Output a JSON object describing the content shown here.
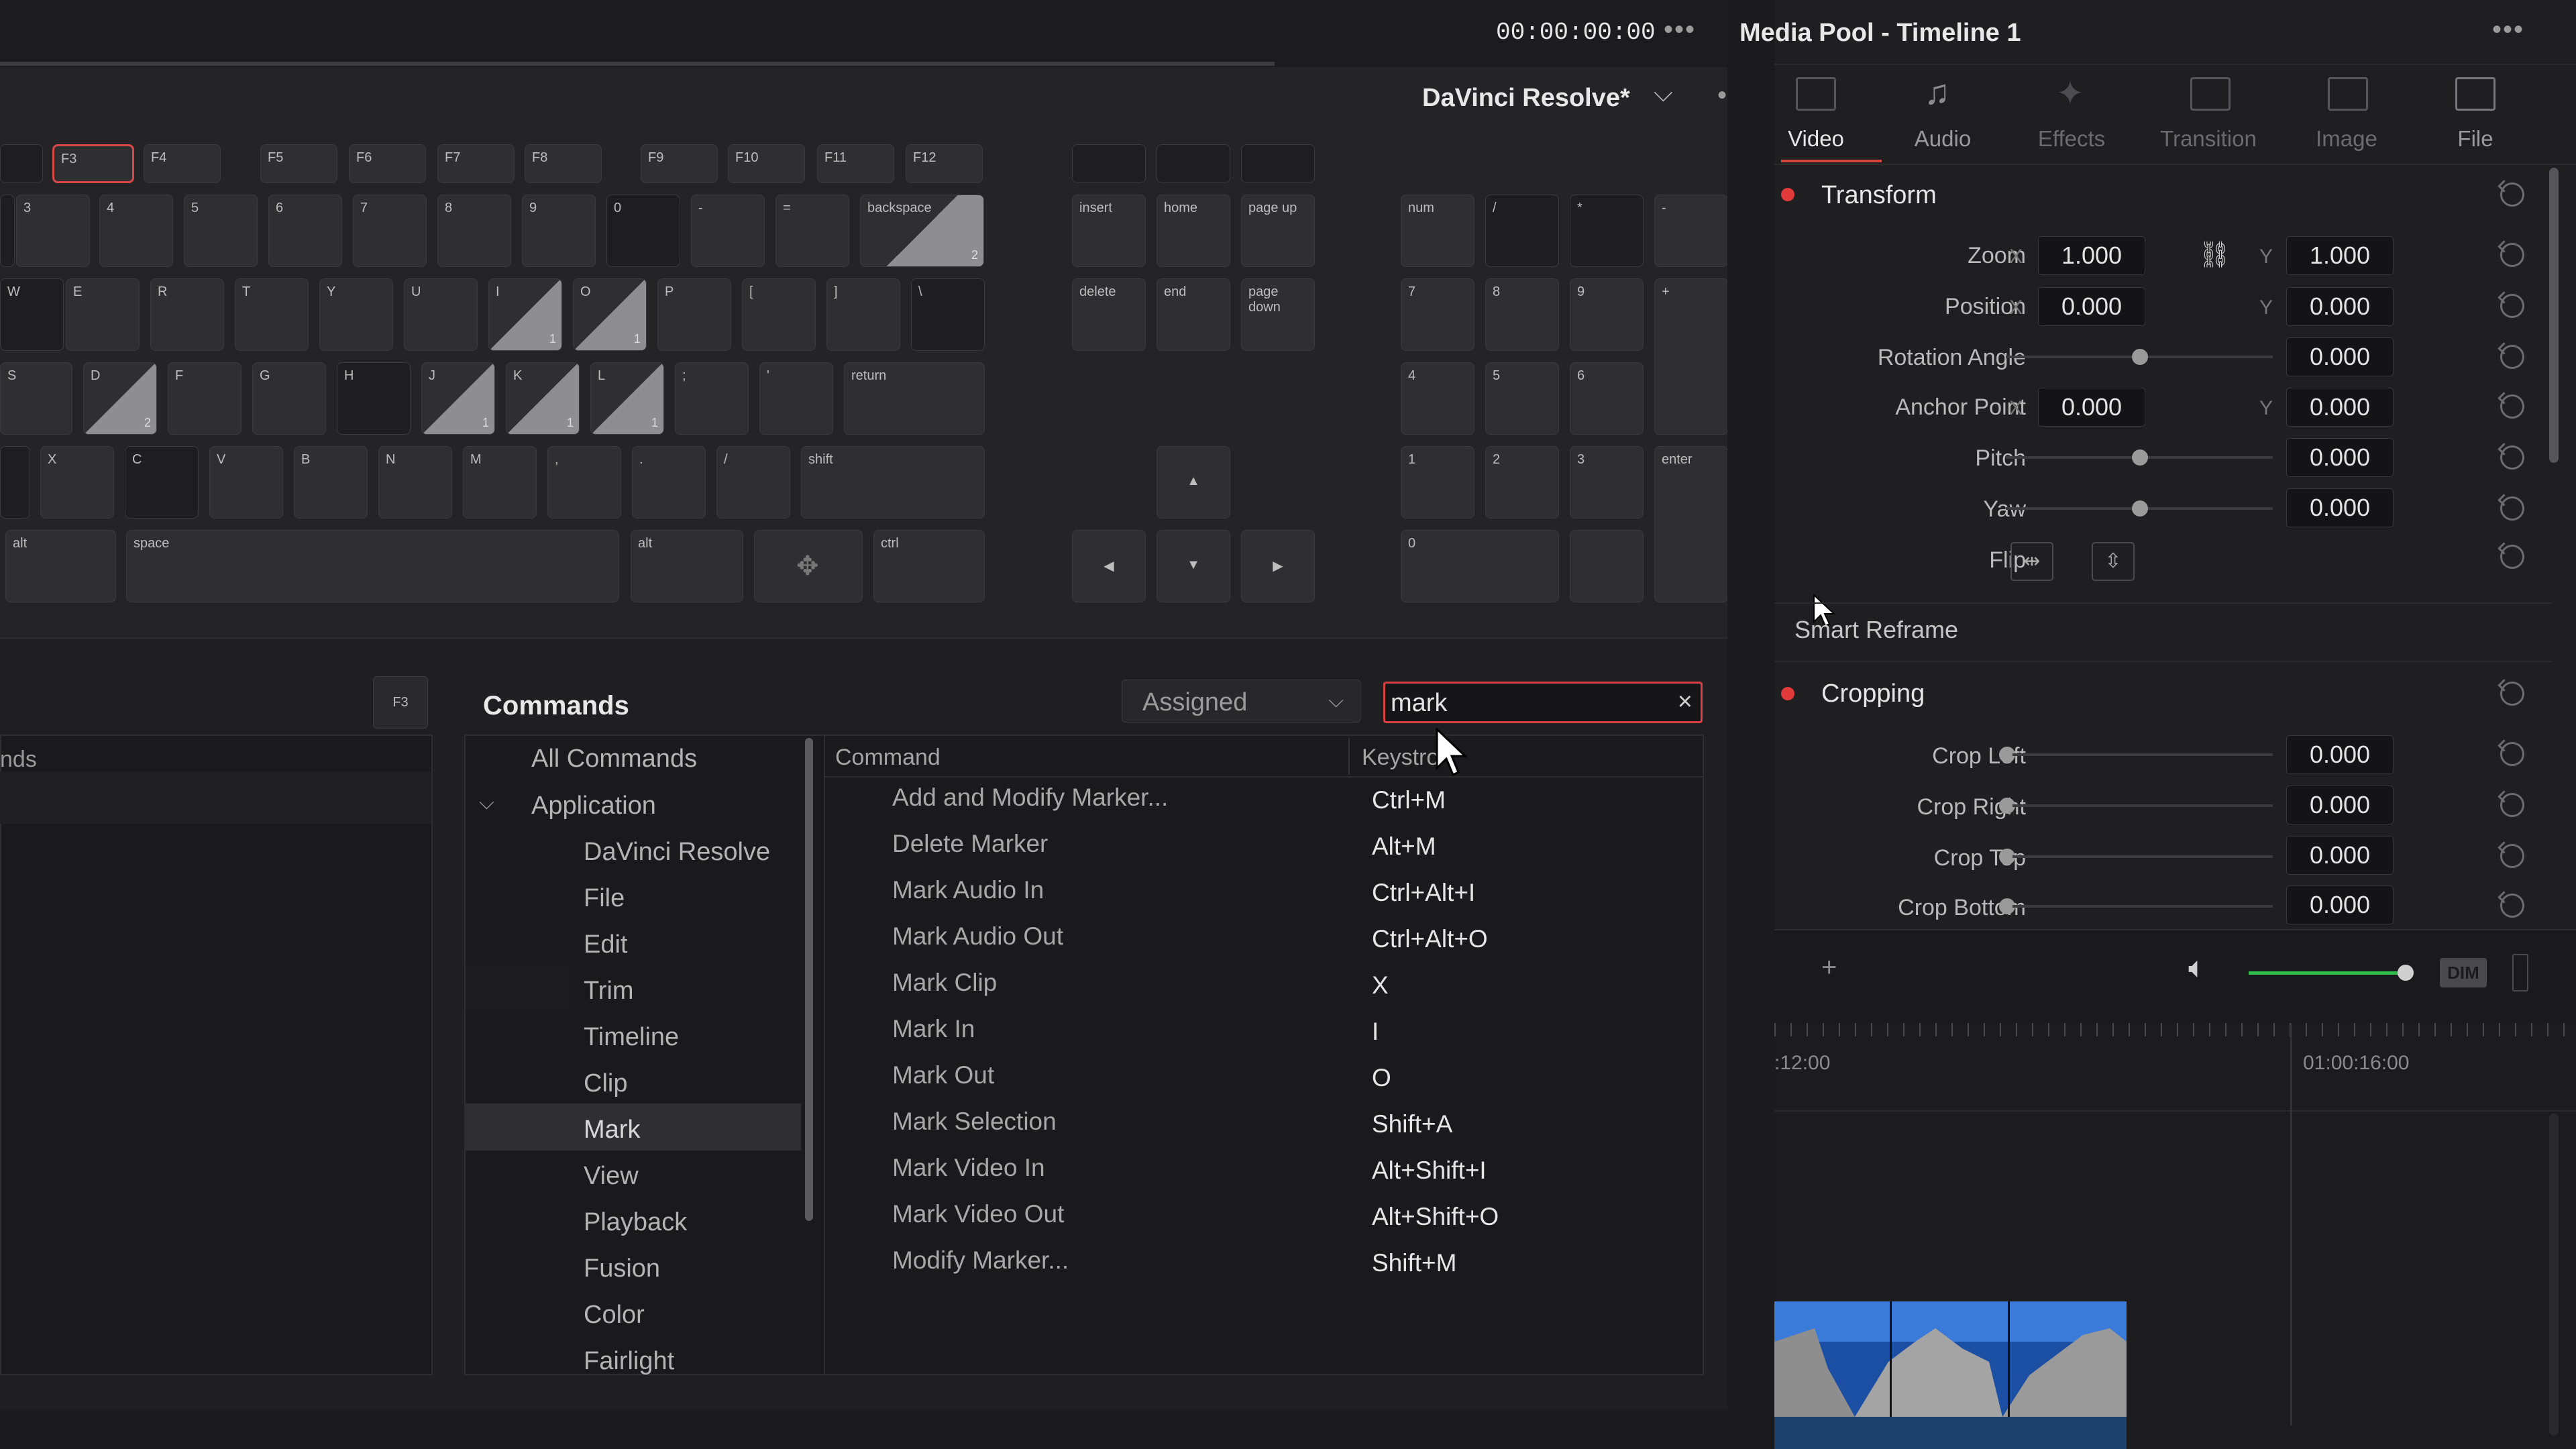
{
  "topbar": {
    "timecode": "00:00:00:00",
    "menu_dots": "•••"
  },
  "editor": {
    "title": "DaVinci Resolve*",
    "menu_dots": "•••",
    "chevron": "⌵"
  },
  "keyboard": {
    "fkeys": [
      "F3",
      "F4",
      "F5",
      "F6",
      "F7",
      "F8",
      "F9",
      "F10",
      "F11",
      "F12"
    ],
    "num_row": [
      "3",
      "4",
      "5",
      "6",
      "7",
      "8",
      "9",
      "0",
      "-",
      "=",
      "backspace"
    ],
    "backspace_count": "2",
    "q_row": [
      "W",
      "E",
      "R",
      "T",
      "Y",
      "U",
      "I",
      "O",
      "P",
      "[",
      "]",
      "\\"
    ],
    "i_count": "1",
    "o_count": "1",
    "a_row": [
      "S",
      "D",
      "F",
      "G",
      "H",
      "J",
      "K",
      "L",
      ";",
      "'",
      "return"
    ],
    "d_count": "2",
    "j_count": "1",
    "k_count": "1",
    "l_count": "1",
    "z_row": [
      "X",
      "C",
      "V",
      "B",
      "N",
      "M",
      ",",
      ".",
      "/",
      "shift"
    ],
    "bottom_row": [
      "alt",
      "space",
      "alt",
      "ctrl"
    ],
    "nav": [
      "insert",
      "home",
      "page up",
      "delete",
      "end",
      "page down"
    ],
    "arrows": [
      "▲",
      "◀",
      "▼",
      "▶"
    ],
    "numpad": [
      "num",
      "/",
      "*",
      "-",
      "7",
      "8",
      "9",
      "+",
      "4",
      "5",
      "6",
      "1",
      "2",
      "3",
      "enter",
      "0",
      "."
    ]
  },
  "commands": {
    "left_header": "nds",
    "f3_badge": "F3",
    "title": "Commands",
    "filter": "Assigned",
    "search_value": "mark",
    "search_clear": "×",
    "col_command": "Command",
    "col_keystroke": "Keystro",
    "tree": [
      "All Commands",
      "Application",
      "DaVinci Resolve",
      "File",
      "Edit",
      "Trim",
      "Timeline",
      "Clip",
      "Mark",
      "View",
      "Playback",
      "Fusion",
      "Color",
      "Fairlight"
    ],
    "rows": [
      {
        "cmd": "Add and Modify Marker...",
        "key": "Ctrl+M"
      },
      {
        "cmd": "Delete Marker",
        "key": "Alt+M"
      },
      {
        "cmd": "Mark Audio In",
        "key": "Ctrl+Alt+I"
      },
      {
        "cmd": "Mark Audio Out",
        "key": "Ctrl+Alt+O"
      },
      {
        "cmd": "Mark Clip",
        "key": "X"
      },
      {
        "cmd": "Mark In",
        "key": "I"
      },
      {
        "cmd": "Mark Out",
        "key": "O"
      },
      {
        "cmd": "Mark Selection",
        "key": "Shift+A"
      },
      {
        "cmd": "Mark Video In",
        "key": "Alt+Shift+I"
      },
      {
        "cmd": "Mark Video Out",
        "key": "Alt+Shift+O"
      },
      {
        "cmd": "Modify Marker...",
        "key": "Shift+M"
      }
    ]
  },
  "inspector": {
    "title": "Media Pool - Timeline 1",
    "menu_dots": "•••",
    "tabs": [
      "Video",
      "Audio",
      "Effects",
      "Transition",
      "Image",
      "File"
    ],
    "transform": {
      "section": "Transform",
      "zoom_label": "Zoom",
      "zoom_x": "1.000",
      "zoom_y": "1.000",
      "position_label": "Position",
      "position_x": "0.000",
      "position_y": "0.000",
      "rotation_label": "Rotation Angle",
      "rotation": "0.000",
      "anchor_label": "Anchor Point",
      "anchor_x": "0.000",
      "anchor_y": "0.000",
      "pitch_label": "Pitch",
      "pitch": "0.000",
      "yaw_label": "Yaw",
      "yaw": "0.000",
      "flip_label": "Flip",
      "x": "X",
      "y": "Y"
    },
    "smart_reframe": "Smart Reframe",
    "cropping": {
      "section": "Cropping",
      "left_label": "Crop Left",
      "left": "0.000",
      "right_label": "Crop Right",
      "right": "0.000",
      "top_label": "Crop Top",
      "top": "0.000",
      "bottom_label": "Crop Bottom",
      "bottom": "0.000"
    },
    "viewer": {
      "plus": "+",
      "dim": "DIM",
      "volume_level": 0.95
    },
    "timeline": {
      "tc1": ":12:00",
      "tc2": "01:00:16:00"
    }
  }
}
